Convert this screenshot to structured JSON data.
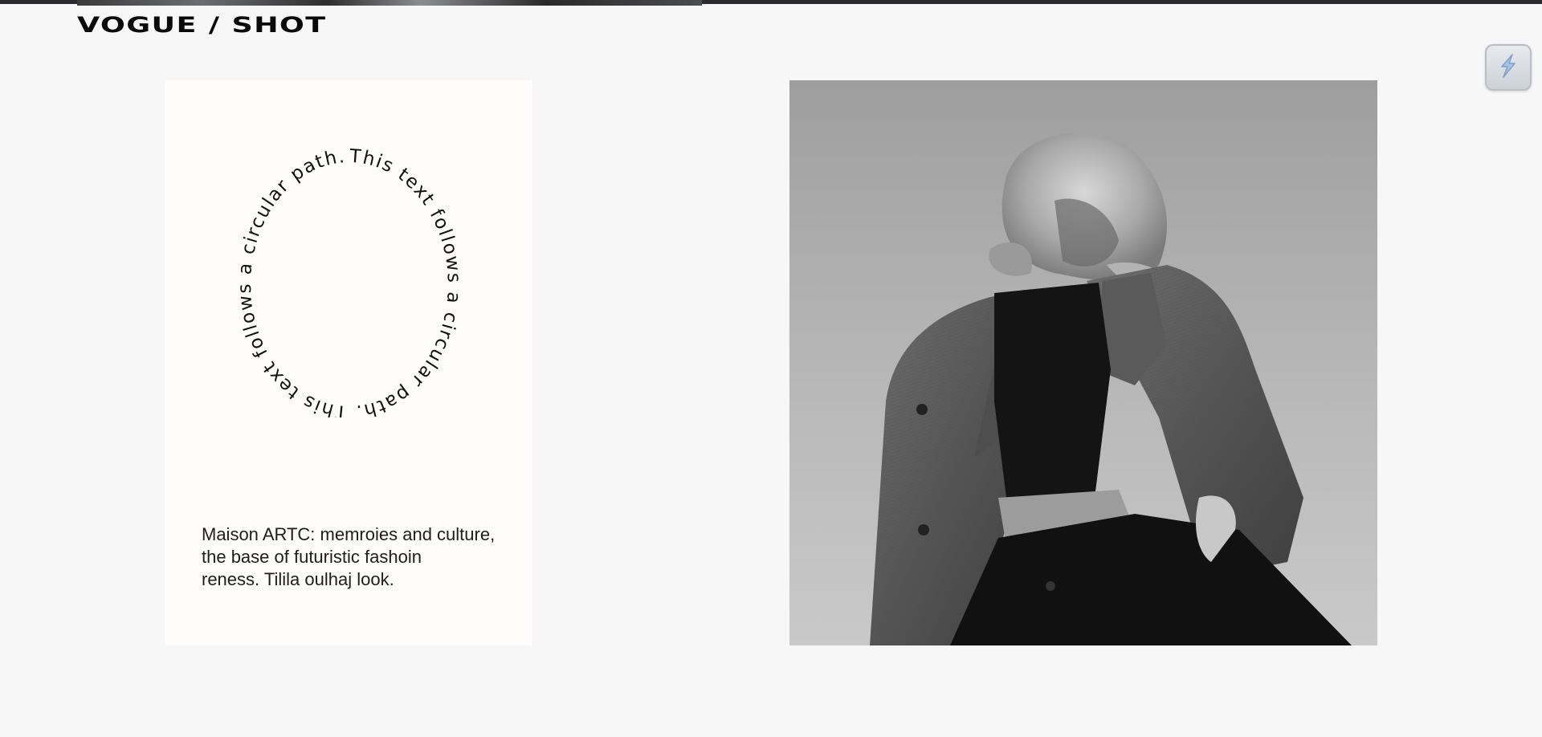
{
  "header": {
    "brand": "VOGUE / SHOT"
  },
  "card": {
    "circular_text": "This text follows a circular path. This text follows a circular path.",
    "description_lines": [
      "Maison ARTC: memroies and culture,",
      "the base of futuristic fashoin",
      "reness. Tilila oulhaj look."
    ]
  },
  "photo": {
    "alt_icon": "fashion-portrait-image"
  },
  "extension": {
    "icon": "bolt-icon"
  },
  "colors": {
    "background": "#f7f7f7",
    "card": "#fefdfb",
    "text": "#1d1d1d",
    "topbar": "#2b2b2f"
  }
}
